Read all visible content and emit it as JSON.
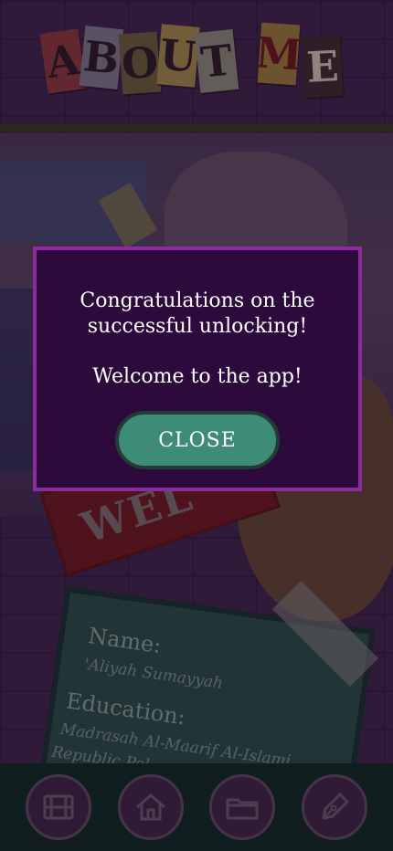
{
  "header": {
    "title_letters": [
      "A",
      "B",
      "O",
      "U",
      "T",
      "M",
      "E"
    ]
  },
  "background": {
    "sign_text": "WEL",
    "card": {
      "name_label": "Name:",
      "name_value": "'Aliyah Sumayyah",
      "education_label": "Education:",
      "education_line1": "Madrasah Al-Maarif Al-Islami",
      "education_line2": "Republic Pol..."
    }
  },
  "dialog": {
    "message_line1": "Congratulations on the",
    "message_line2": "successful unlocking!",
    "message_welcome": "Welcome to the app!",
    "close_label": "CLOSE"
  },
  "nav": {
    "items": [
      {
        "icon": "film-icon"
      },
      {
        "icon": "home-icon"
      },
      {
        "icon": "folder-icon"
      },
      {
        "icon": "pen-nib-icon"
      }
    ]
  },
  "colors": {
    "dialog_bg": "#2c0a3c",
    "dialog_border": "#8c2aa0",
    "close_button": "#3e8c78",
    "nav_bg": "#0d2a22"
  }
}
